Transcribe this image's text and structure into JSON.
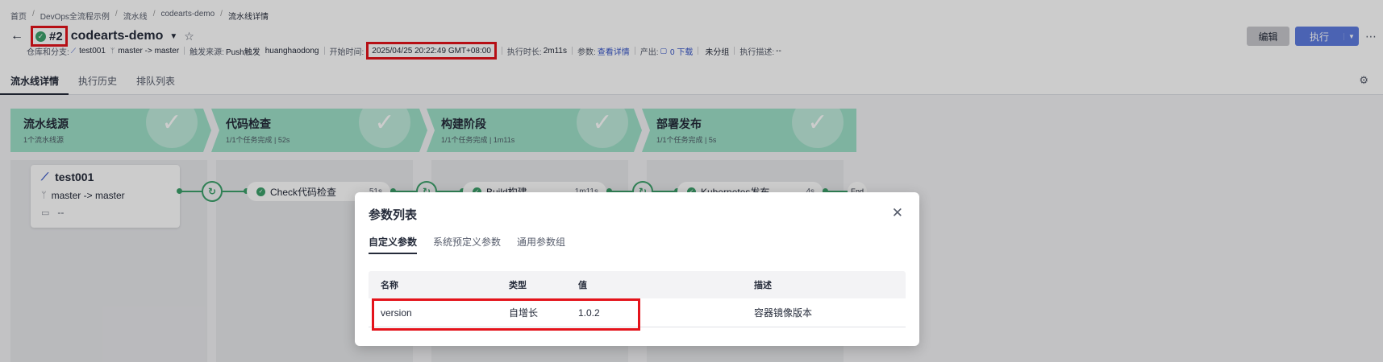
{
  "breadcrumb": [
    "首页",
    "DevOps全流程示例",
    "流水线",
    "codearts-demo",
    "流水线详情"
  ],
  "header": {
    "run_no": "#2",
    "pipeline_name": "codearts-demo"
  },
  "meta": {
    "repo_label": "仓库和分支:",
    "repo": "test001",
    "branch": "master -> master",
    "trigger_label": "触发来源:",
    "trigger": "Push触发",
    "trigger_user": "huanghaodong",
    "start_label": "开始时间:",
    "start_time": "2025/04/25 20:22:49 GMT+08:00",
    "duration_label": "执行时长:",
    "duration": "2m11s",
    "params_label": "参数:",
    "params_link": "查看详情",
    "output_label": "产出:",
    "output_link": "0 下载",
    "group": "未分组",
    "desc_label": "执行描述:",
    "desc": "--"
  },
  "actions": {
    "edit": "编辑",
    "run": "执行"
  },
  "tabs": [
    "流水线详情",
    "执行历史",
    "排队列表"
  ],
  "stages": [
    {
      "title": "流水线源",
      "sub": "1个流水线源"
    },
    {
      "title": "代码检查",
      "sub": "1/1个任务完成  |  52s"
    },
    {
      "title": "构建阶段",
      "sub": "1/1个任务完成  |  1m11s"
    },
    {
      "title": "部署发布",
      "sub": "1/1个任务完成  |  5s"
    }
  ],
  "source_card": {
    "repo": "test001",
    "branch": "master -> master",
    "artifact": "--"
  },
  "jobs": [
    {
      "name": "Check代码检查",
      "time": "51s"
    },
    {
      "name": "Build构建",
      "time": "1m11s"
    },
    {
      "name": "Kubernetes发布",
      "time": "4s"
    }
  ],
  "end_label": "End",
  "modal": {
    "title": "参数列表",
    "tabs": [
      "自定义参数",
      "系统预定义参数",
      "通用参数组"
    ],
    "columns": [
      "名称",
      "类型",
      "值",
      "描述"
    ],
    "rows": [
      {
        "name": "version",
        "type": "自增长",
        "value": "1.0.2",
        "desc": "容器镜像版本"
      }
    ]
  },
  "colors": {
    "success": "#3ca06b",
    "stage_bg": "#9ee0c9",
    "primary": "#5e7ce0",
    "highlight": "#e4131b"
  }
}
